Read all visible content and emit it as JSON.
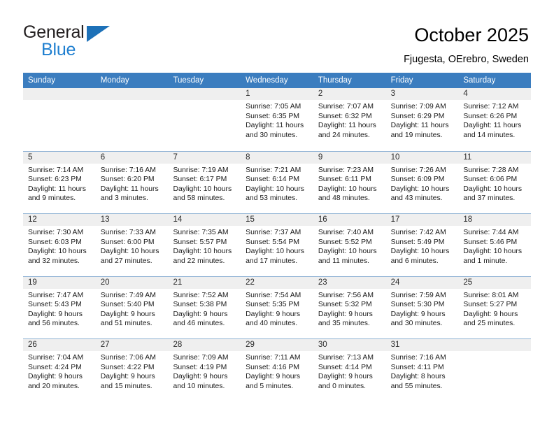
{
  "brand": {
    "name_part1": "General",
    "name_part2": "Blue",
    "logo_icon": "blue-triangle-icon",
    "color_dark": "#231f20",
    "color_blue": "#1f7fd0"
  },
  "header": {
    "title": "October 2025",
    "location": "Fjugesta, OErebro, Sweden"
  },
  "calendar": {
    "header_background": "#3b7dbf",
    "weekdays": [
      "Sunday",
      "Monday",
      "Tuesday",
      "Wednesday",
      "Thursday",
      "Friday",
      "Saturday"
    ],
    "weeks": [
      [
        {
          "day": "",
          "sunrise": "",
          "sunset": "",
          "daylight": "",
          "empty": true
        },
        {
          "day": "",
          "sunrise": "",
          "sunset": "",
          "daylight": "",
          "empty": true
        },
        {
          "day": "",
          "sunrise": "",
          "sunset": "",
          "daylight": "",
          "empty": true
        },
        {
          "day": "1",
          "sunrise": "Sunrise: 7:05 AM",
          "sunset": "Sunset: 6:35 PM",
          "daylight": "Daylight: 11 hours and 30 minutes."
        },
        {
          "day": "2",
          "sunrise": "Sunrise: 7:07 AM",
          "sunset": "Sunset: 6:32 PM",
          "daylight": "Daylight: 11 hours and 24 minutes."
        },
        {
          "day": "3",
          "sunrise": "Sunrise: 7:09 AM",
          "sunset": "Sunset: 6:29 PM",
          "daylight": "Daylight: 11 hours and 19 minutes."
        },
        {
          "day": "4",
          "sunrise": "Sunrise: 7:12 AM",
          "sunset": "Sunset: 6:26 PM",
          "daylight": "Daylight: 11 hours and 14 minutes."
        }
      ],
      [
        {
          "day": "5",
          "sunrise": "Sunrise: 7:14 AM",
          "sunset": "Sunset: 6:23 PM",
          "daylight": "Daylight: 11 hours and 9 minutes."
        },
        {
          "day": "6",
          "sunrise": "Sunrise: 7:16 AM",
          "sunset": "Sunset: 6:20 PM",
          "daylight": "Daylight: 11 hours and 3 minutes."
        },
        {
          "day": "7",
          "sunrise": "Sunrise: 7:19 AM",
          "sunset": "Sunset: 6:17 PM",
          "daylight": "Daylight: 10 hours and 58 minutes."
        },
        {
          "day": "8",
          "sunrise": "Sunrise: 7:21 AM",
          "sunset": "Sunset: 6:14 PM",
          "daylight": "Daylight: 10 hours and 53 minutes."
        },
        {
          "day": "9",
          "sunrise": "Sunrise: 7:23 AM",
          "sunset": "Sunset: 6:11 PM",
          "daylight": "Daylight: 10 hours and 48 minutes."
        },
        {
          "day": "10",
          "sunrise": "Sunrise: 7:26 AM",
          "sunset": "Sunset: 6:09 PM",
          "daylight": "Daylight: 10 hours and 43 minutes."
        },
        {
          "day": "11",
          "sunrise": "Sunrise: 7:28 AM",
          "sunset": "Sunset: 6:06 PM",
          "daylight": "Daylight: 10 hours and 37 minutes."
        }
      ],
      [
        {
          "day": "12",
          "sunrise": "Sunrise: 7:30 AM",
          "sunset": "Sunset: 6:03 PM",
          "daylight": "Daylight: 10 hours and 32 minutes."
        },
        {
          "day": "13",
          "sunrise": "Sunrise: 7:33 AM",
          "sunset": "Sunset: 6:00 PM",
          "daylight": "Daylight: 10 hours and 27 minutes."
        },
        {
          "day": "14",
          "sunrise": "Sunrise: 7:35 AM",
          "sunset": "Sunset: 5:57 PM",
          "daylight": "Daylight: 10 hours and 22 minutes."
        },
        {
          "day": "15",
          "sunrise": "Sunrise: 7:37 AM",
          "sunset": "Sunset: 5:54 PM",
          "daylight": "Daylight: 10 hours and 17 minutes."
        },
        {
          "day": "16",
          "sunrise": "Sunrise: 7:40 AM",
          "sunset": "Sunset: 5:52 PM",
          "daylight": "Daylight: 10 hours and 11 minutes."
        },
        {
          "day": "17",
          "sunrise": "Sunrise: 7:42 AM",
          "sunset": "Sunset: 5:49 PM",
          "daylight": "Daylight: 10 hours and 6 minutes."
        },
        {
          "day": "18",
          "sunrise": "Sunrise: 7:44 AM",
          "sunset": "Sunset: 5:46 PM",
          "daylight": "Daylight: 10 hours and 1 minute."
        }
      ],
      [
        {
          "day": "19",
          "sunrise": "Sunrise: 7:47 AM",
          "sunset": "Sunset: 5:43 PM",
          "daylight": "Daylight: 9 hours and 56 minutes."
        },
        {
          "day": "20",
          "sunrise": "Sunrise: 7:49 AM",
          "sunset": "Sunset: 5:40 PM",
          "daylight": "Daylight: 9 hours and 51 minutes."
        },
        {
          "day": "21",
          "sunrise": "Sunrise: 7:52 AM",
          "sunset": "Sunset: 5:38 PM",
          "daylight": "Daylight: 9 hours and 46 minutes."
        },
        {
          "day": "22",
          "sunrise": "Sunrise: 7:54 AM",
          "sunset": "Sunset: 5:35 PM",
          "daylight": "Daylight: 9 hours and 40 minutes."
        },
        {
          "day": "23",
          "sunrise": "Sunrise: 7:56 AM",
          "sunset": "Sunset: 5:32 PM",
          "daylight": "Daylight: 9 hours and 35 minutes."
        },
        {
          "day": "24",
          "sunrise": "Sunrise: 7:59 AM",
          "sunset": "Sunset: 5:30 PM",
          "daylight": "Daylight: 9 hours and 30 minutes."
        },
        {
          "day": "25",
          "sunrise": "Sunrise: 8:01 AM",
          "sunset": "Sunset: 5:27 PM",
          "daylight": "Daylight: 9 hours and 25 minutes."
        }
      ],
      [
        {
          "day": "26",
          "sunrise": "Sunrise: 7:04 AM",
          "sunset": "Sunset: 4:24 PM",
          "daylight": "Daylight: 9 hours and 20 minutes."
        },
        {
          "day": "27",
          "sunrise": "Sunrise: 7:06 AM",
          "sunset": "Sunset: 4:22 PM",
          "daylight": "Daylight: 9 hours and 15 minutes."
        },
        {
          "day": "28",
          "sunrise": "Sunrise: 7:09 AM",
          "sunset": "Sunset: 4:19 PM",
          "daylight": "Daylight: 9 hours and 10 minutes."
        },
        {
          "day": "29",
          "sunrise": "Sunrise: 7:11 AM",
          "sunset": "Sunset: 4:16 PM",
          "daylight": "Daylight: 9 hours and 5 minutes."
        },
        {
          "day": "30",
          "sunrise": "Sunrise: 7:13 AM",
          "sunset": "Sunset: 4:14 PM",
          "daylight": "Daylight: 9 hours and 0 minutes."
        },
        {
          "day": "31",
          "sunrise": "Sunrise: 7:16 AM",
          "sunset": "Sunset: 4:11 PM",
          "daylight": "Daylight: 8 hours and 55 minutes."
        },
        {
          "day": "",
          "sunrise": "",
          "sunset": "",
          "daylight": "",
          "empty": true
        }
      ]
    ]
  }
}
